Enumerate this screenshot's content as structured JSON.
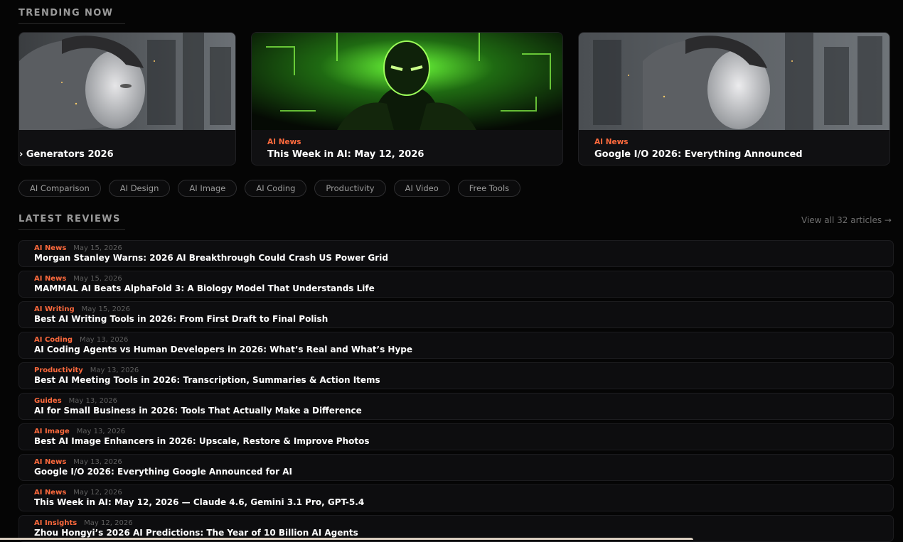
{
  "trending": {
    "title": "TRENDING NOW",
    "cards": [
      {
        "category": "",
        "title": "› Generators 2026",
        "image": "robot-woman-portrait"
      },
      {
        "category": "AI News",
        "title": "This Week in AI: May 12, 2026",
        "image": "green-neon-robot"
      },
      {
        "category": "AI News",
        "title": "Google I/O 2026: Everything Announced",
        "image": "robot-woman-portrait"
      }
    ]
  },
  "tags": [
    "AI Comparison",
    "AI Design",
    "AI Image",
    "AI Coding",
    "Productivity",
    "AI Video",
    "Free Tools"
  ],
  "latest": {
    "title": "LATEST REVIEWS",
    "view_all": "View all 32 articles →",
    "items": [
      {
        "category": "AI News",
        "date": "May 15, 2026",
        "title": "Morgan Stanley Warns: 2026 AI Breakthrough Could Crash US Power Grid"
      },
      {
        "category": "AI News",
        "date": "May 15, 2026",
        "title": "MAMMAL AI Beats AlphaFold 3: A Biology Model That Understands Life"
      },
      {
        "category": "AI Writing",
        "date": "May 15, 2026",
        "title": "Best AI Writing Tools in 2026: From First Draft to Final Polish"
      },
      {
        "category": "AI Coding",
        "date": "May 13, 2026",
        "title": "AI Coding Agents vs Human Developers in 2026: What’s Real and What’s Hype"
      },
      {
        "category": "Productivity",
        "date": "May 13, 2026",
        "title": "Best AI Meeting Tools in 2026: Transcription, Summaries & Action Items"
      },
      {
        "category": "Guides",
        "date": "May 13, 2026",
        "title": "AI for Small Business in 2026: Tools That Actually Make a Difference"
      },
      {
        "category": "AI Image",
        "date": "May 13, 2026",
        "title": "Best AI Image Enhancers in 2026: Upscale, Restore & Improve Photos"
      },
      {
        "category": "AI News",
        "date": "May 13, 2026",
        "title": "Google I/O 2026: Everything Google Announced for AI"
      },
      {
        "category": "AI News",
        "date": "May 12, 2026",
        "title": "This Week in AI: May 12, 2026 — Claude 4.6, Gemini 3.1 Pro, GPT-5.4"
      },
      {
        "category": "AI Insights",
        "date": "May 12, 2026",
        "title": "Zhou Hongyi’s 2026 AI Predictions: The Year of 10 Billion AI Agents"
      }
    ]
  },
  "colors": {
    "accent": "#ff6a3d",
    "background": "#050505",
    "card": "#101012"
  }
}
